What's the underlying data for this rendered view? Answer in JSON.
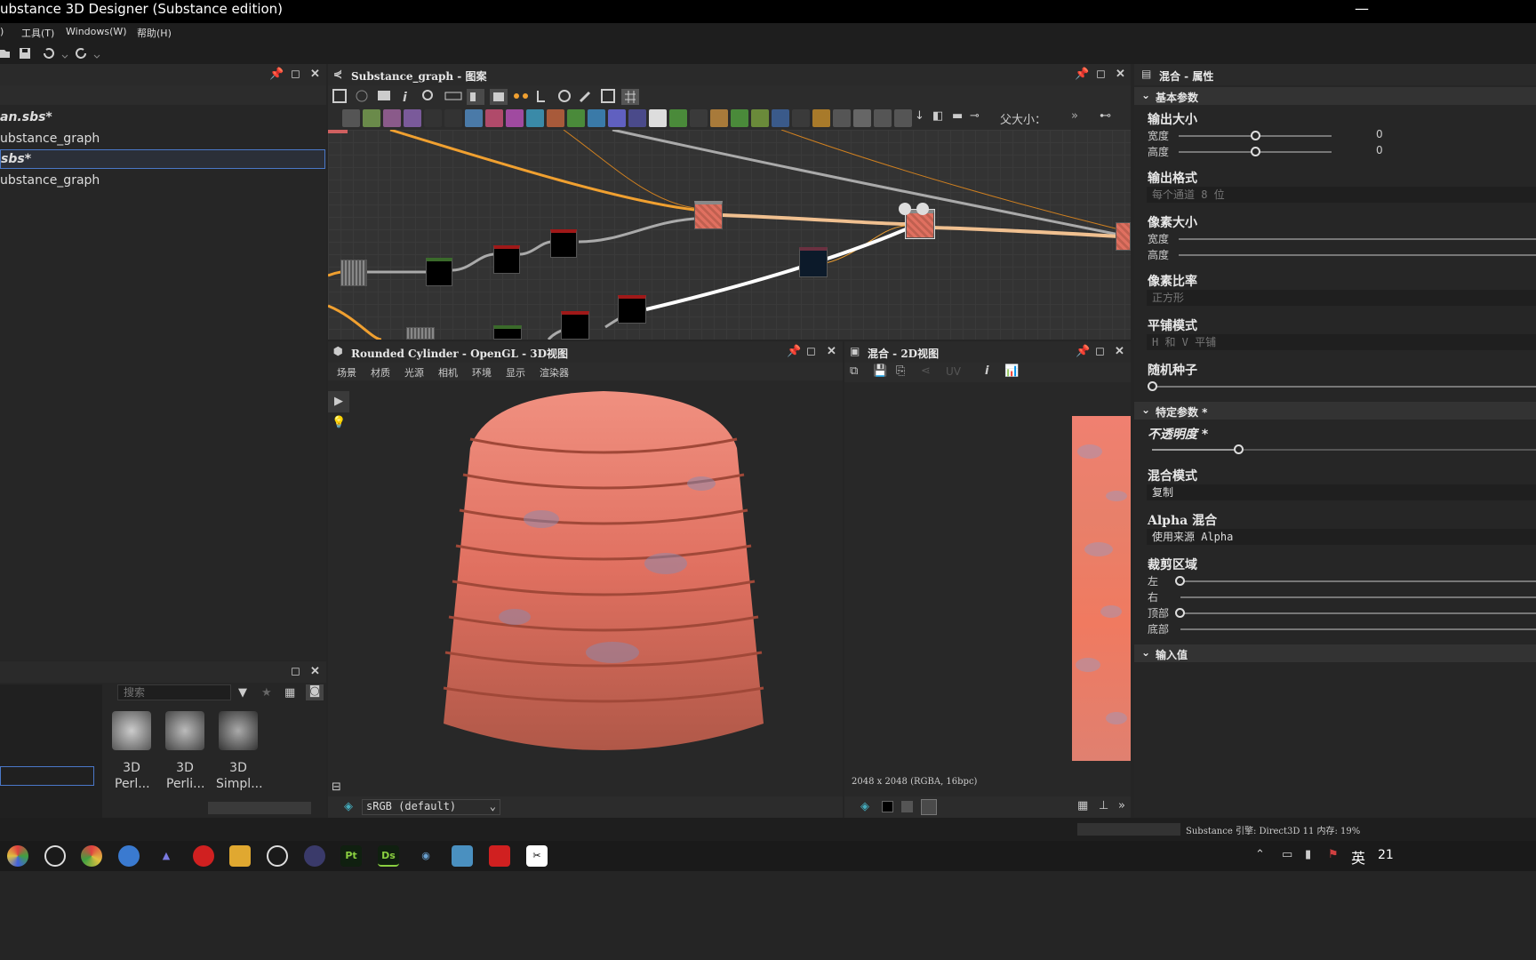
{
  "window": {
    "title": "ubstance 3D Designer (Substance edition)",
    "minimize_glyph": "—"
  },
  "menu": {
    "items": [
      ")",
      "工具(T)",
      "Windows(W)",
      "帮助(H)"
    ]
  },
  "explorer": {
    "items": [
      "an.sbs*",
      "ubstance_graph",
      "sbs*",
      "ubstance_graph"
    ]
  },
  "graph": {
    "title": "Substance_graph - 图案",
    "output_size_label": "父大小：",
    "more_glyph": "»"
  },
  "view3d": {
    "title": "Rounded Cylinder - OpenGL - 3D视图",
    "menu": [
      "场景",
      "材质",
      "光源",
      "相机",
      "环境",
      "显示",
      "渲染器"
    ],
    "colorspace": "sRGB (default)"
  },
  "view2d": {
    "title": "混合 - 2D视图",
    "uv_label": "UV",
    "info": "2048 x 2048 (RGBA, 16bpc)"
  },
  "props": {
    "title": "混合 - 属性",
    "basic_section": "基本参数",
    "output_size": "输出大小",
    "width": "宽度",
    "height": "高度",
    "width_value": "0",
    "height_value": "0",
    "output_format": "输出格式",
    "output_format_value": "每个通道 8 位",
    "pixel_size": "像素大小",
    "pixel_ratio": "像素比率",
    "pixel_ratio_value": "正方形",
    "tiling_mode": "平铺模式",
    "tiling_mode_value": "H 和 V 平铺",
    "random_seed": "随机种子",
    "specific_section": "特定参数 *",
    "opacity": "不透明度 *",
    "blend_mode": "混合模式",
    "blend_mode_value": "复制",
    "alpha_blend": "Alpha 混合",
    "alpha_blend_value": "使用来源 Alpha",
    "crop": "裁剪区域",
    "left": "左",
    "right": "右",
    "top": "顶部",
    "bottom": "底部",
    "inputs_section": "输入值"
  },
  "library": {
    "search_placeholder": "搜索",
    "items": [
      {
        "l1": "3D",
        "l2": "Perl..."
      },
      {
        "l1": "3D",
        "l2": "Perli..."
      },
      {
        "l1": "3D",
        "l2": "Simpl..."
      }
    ]
  },
  "status": {
    "text": "Substance 引擎: Direct3D 11 内存: 19%"
  },
  "taskbar": {
    "apps": [
      "Pt",
      "Ds"
    ],
    "ime": "英",
    "clock": "21"
  }
}
